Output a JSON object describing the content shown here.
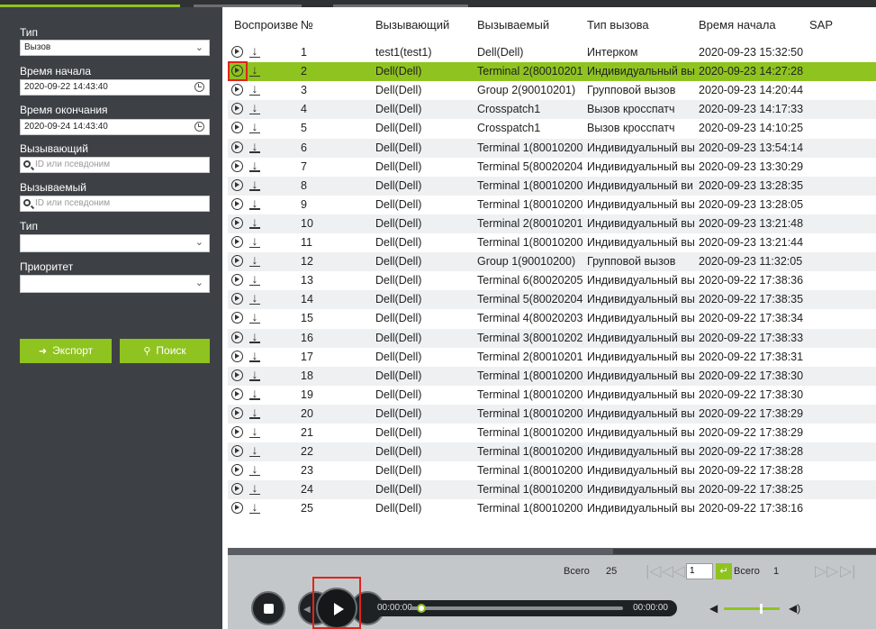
{
  "colors": {
    "accent": "#8fc31f",
    "sidebar_bg": "#3d4145",
    "highlight_border": "#e0241b",
    "player_bg": "#c4c7ca"
  },
  "filters": {
    "type_label": "Тип",
    "type_value": "Вызов",
    "start_label": "Время начала",
    "start_value": "2020-09-22 14:43:40",
    "end_label": "Время окончания",
    "end_value": "2020-09-24 14:43:40",
    "caller_label": "Вызывающий",
    "caller_placeholder": "ID или псевдоним",
    "callee_label": "Вызываемый",
    "callee_placeholder": "ID или псевдоним",
    "type2_label": "Тип",
    "type2_value": "",
    "priority_label": "Приоритет",
    "priority_value": "",
    "export_label": "Экспорт",
    "search_label": "Поиск"
  },
  "table": {
    "columns": [
      "Воспроизве",
      "№",
      "Вызывающий",
      "Вызываемый",
      "Тип вызова",
      "Время начала",
      "SAP"
    ],
    "rows": [
      {
        "no": "1",
        "caller": "test1(test1)",
        "callee": "Dell(Dell)",
        "type": "Интерком",
        "time": "2020-09-23 15:32:50"
      },
      {
        "no": "2",
        "caller": "Dell(Dell)",
        "callee": "Terminal 2(80010201)",
        "type": "Индивидуальный вы",
        "time": "2020-09-23 14:27:28"
      },
      {
        "no": "3",
        "caller": "Dell(Dell)",
        "callee": "Group 2(90010201)",
        "type": "Групповой вызов",
        "time": "2020-09-23 14:20:44"
      },
      {
        "no": "4",
        "caller": "Dell(Dell)",
        "callee": "Crosspatch1",
        "type": "Вызов кросспатч",
        "time": "2020-09-23 14:17:33"
      },
      {
        "no": "5",
        "caller": "Dell(Dell)",
        "callee": "Crosspatch1",
        "type": "Вызов кросспатч",
        "time": "2020-09-23 14:10:25"
      },
      {
        "no": "6",
        "caller": "Dell(Dell)",
        "callee": "Terminal 1(80010200)",
        "type": "Индивидуальный вы",
        "time": "2020-09-23 13:54:14"
      },
      {
        "no": "7",
        "caller": "Dell(Dell)",
        "callee": "Terminal 5(80020204)",
        "type": "Индивидуальный вы",
        "time": "2020-09-23 13:30:29"
      },
      {
        "no": "8",
        "caller": "Dell(Dell)",
        "callee": "Terminal 1(80010200)",
        "type": "Индивидуальный ви",
        "time": "2020-09-23 13:28:35"
      },
      {
        "no": "9",
        "caller": "Dell(Dell)",
        "callee": "Terminal 1(80010200)",
        "type": "Индивидуальный вы",
        "time": "2020-09-23 13:28:05"
      },
      {
        "no": "10",
        "caller": "Dell(Dell)",
        "callee": "Terminal 2(80010201)",
        "type": "Индивидуальный вы",
        "time": "2020-09-23 13:21:48"
      },
      {
        "no": "11",
        "caller": "Dell(Dell)",
        "callee": "Terminal 1(80010200)",
        "type": "Индивидуальный вы",
        "time": "2020-09-23 13:21:44"
      },
      {
        "no": "12",
        "caller": "Dell(Dell)",
        "callee": "Group 1(90010200)",
        "type": "Групповой вызов",
        "time": "2020-09-23 11:32:05"
      },
      {
        "no": "13",
        "caller": "Dell(Dell)",
        "callee": "Terminal 6(80020205)",
        "type": "Индивидуальный вы",
        "time": "2020-09-22 17:38:36"
      },
      {
        "no": "14",
        "caller": "Dell(Dell)",
        "callee": "Terminal 5(80020204)",
        "type": "Индивидуальный вы",
        "time": "2020-09-22 17:38:35"
      },
      {
        "no": "15",
        "caller": "Dell(Dell)",
        "callee": "Terminal 4(80020203)",
        "type": "Индивидуальный вы",
        "time": "2020-09-22 17:38:34"
      },
      {
        "no": "16",
        "caller": "Dell(Dell)",
        "callee": "Terminal 3(80010202)",
        "type": "Индивидуальный вы",
        "time": "2020-09-22 17:38:33"
      },
      {
        "no": "17",
        "caller": "Dell(Dell)",
        "callee": "Terminal 2(80010201)",
        "type": "Индивидуальный вы",
        "time": "2020-09-22 17:38:31"
      },
      {
        "no": "18",
        "caller": "Dell(Dell)",
        "callee": "Terminal 1(80010200)",
        "type": "Индивидуальный вы",
        "time": "2020-09-22 17:38:30"
      },
      {
        "no": "19",
        "caller": "Dell(Dell)",
        "callee": "Terminal 1(80010200)",
        "type": "Индивидуальный вы",
        "time": "2020-09-22 17:38:30"
      },
      {
        "no": "20",
        "caller": "Dell(Dell)",
        "callee": "Terminal 1(80010200)",
        "type": "Индивидуальный вы",
        "time": "2020-09-22 17:38:29"
      },
      {
        "no": "21",
        "caller": "Dell(Dell)",
        "callee": "Terminal 1(80010200)",
        "type": "Индивидуальный вы",
        "time": "2020-09-22 17:38:29"
      },
      {
        "no": "22",
        "caller": "Dell(Dell)",
        "callee": "Terminal 1(80010200)",
        "type": "Индивидуальный вы",
        "time": "2020-09-22 17:38:28"
      },
      {
        "no": "23",
        "caller": "Dell(Dell)",
        "callee": "Terminal 1(80010200)",
        "type": "Индивидуальный вы",
        "time": "2020-09-22 17:38:28"
      },
      {
        "no": "24",
        "caller": "Dell(Dell)",
        "callee": "Terminal 1(80010200)",
        "type": "Индивидуальный вы",
        "time": "2020-09-22 17:38:25"
      },
      {
        "no": "25",
        "caller": "Dell(Dell)",
        "callee": "Terminal 1(80010200)",
        "type": "Индивидуальный вы",
        "time": "2020-09-22 17:38:16"
      }
    ],
    "selected_no": "2"
  },
  "pagination": {
    "total_label": "Всего",
    "total_value": "25",
    "page_value": "1",
    "pages_label": "Всего",
    "pages_value": "1"
  },
  "player": {
    "time_current": "00:00:00",
    "time_total": "00:00:00",
    "volume": 0.7
  }
}
